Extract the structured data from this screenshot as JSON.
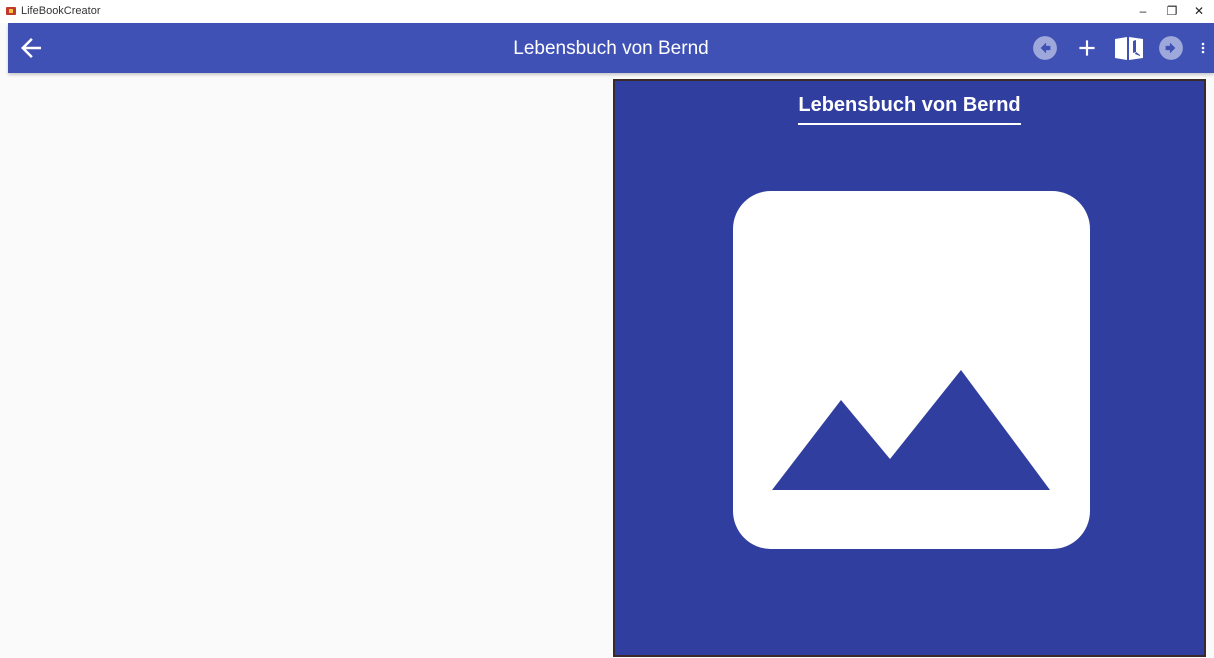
{
  "window": {
    "app_title": "LifeBookCreator",
    "minimize": "–",
    "maximize": "❐",
    "close": "✕"
  },
  "appbar": {
    "title": "Lebensbuch von Bernd",
    "back_icon": "arrow-back-icon",
    "actions": [
      {
        "name": "previous-page",
        "icon": "arrow-circle-left-icon",
        "enabled": false
      },
      {
        "name": "add",
        "icon": "plus-icon",
        "enabled": true
      },
      {
        "name": "book",
        "icon": "open-book-icon",
        "enabled": true
      },
      {
        "name": "next-page",
        "icon": "arrow-circle-right-icon",
        "enabled": false
      },
      {
        "name": "more",
        "icon": "more-vert-icon",
        "enabled": true
      }
    ]
  },
  "page": {
    "title": "Lebensbuch von Bernd",
    "image_icon": "image-placeholder-icon"
  },
  "colors": {
    "appbar": "#3f51b5",
    "page_background": "#303f9f",
    "disabled_icon": "#9fa8da"
  }
}
